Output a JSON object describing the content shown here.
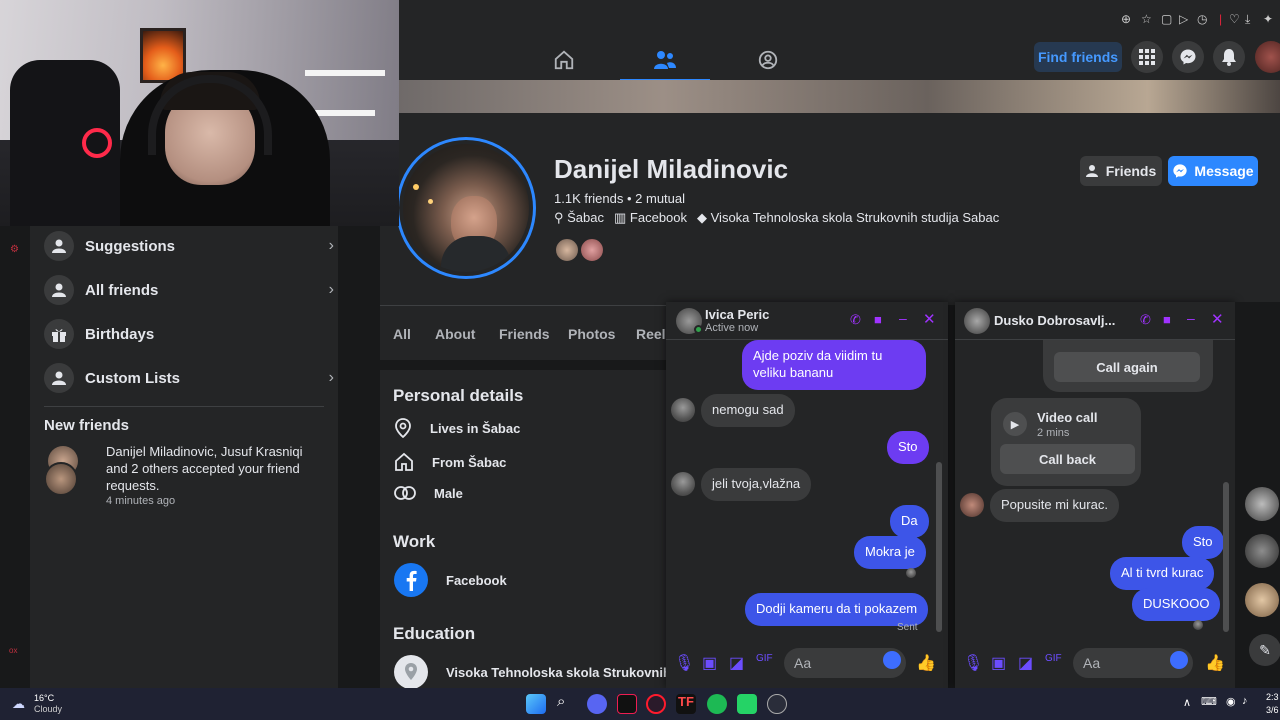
{
  "topnav": {
    "find_friends": "Find friends"
  },
  "profile": {
    "name": "Danijel Miladinovic",
    "friends_line": "1.1K friends • 2 mutual",
    "location": "Šabac",
    "work": "Facebook",
    "school": "Visoka Tehnoloska skola Strukovnih studija Sabac",
    "btn_friends": "Friends",
    "btn_message": "Message"
  },
  "tabs": [
    "All",
    "About",
    "Friends",
    "Photos",
    "Reels"
  ],
  "sidebar": {
    "items": [
      {
        "label": "Suggestions",
        "icon": "person-icon"
      },
      {
        "label": "All friends",
        "icon": "person-icon"
      },
      {
        "label": "Birthdays",
        "icon": "gift-icon"
      },
      {
        "label": "Custom Lists",
        "icon": "list-icon"
      }
    ],
    "new_friends_title": "New friends",
    "notification_text": "Danijel Miladinovic, Jusuf Krasniqi and 2 others accepted your friend requests.",
    "notification_time": "4 minutes ago"
  },
  "intro": {
    "personal_title": "Personal details",
    "lives_in": "Lives in Šabac",
    "from": "From Šabac",
    "gender": "Male",
    "work_title": "Work",
    "work_item": "Facebook",
    "edu_title": "Education",
    "edu_item": "Visoka Tehnoloska skola Strukovnih stu"
  },
  "chat1": {
    "name": "Ivica Peric",
    "status": "Active now",
    "messages": [
      {
        "dir": "out",
        "text": "Ajde poziv da viidim tu veliku bananu"
      },
      {
        "dir": "in",
        "text": "nemogu sad"
      },
      {
        "dir": "out",
        "text": "Sto"
      },
      {
        "dir": "in",
        "text": "jeli tvoja,vlažna"
      },
      {
        "dir": "out",
        "text": "Da"
      },
      {
        "dir": "out",
        "text": "Mokra je"
      },
      {
        "dir": "out",
        "text": "Dodji kameru da ti pokazem"
      }
    ],
    "sent_label": "Sent",
    "input_placeholder": "Aa"
  },
  "chat2": {
    "name": "Dusko Dobrosavlj...",
    "call_again": "Call again",
    "video_call_title": "Video call",
    "video_call_time": "2 mins",
    "call_back": "Call back",
    "messages": [
      {
        "dir": "in",
        "text": "Popusite mi kurac."
      },
      {
        "dir": "out",
        "text": "Sto"
      },
      {
        "dir": "out",
        "text": "Al ti tvrd kurac"
      },
      {
        "dir": "out",
        "text": "DUSKOOO"
      }
    ],
    "input_placeholder": "Aa"
  },
  "taskbar": {
    "weather_temp": "16°C",
    "weather_desc": "Cloudy",
    "time": "2:3",
    "date": "3/6"
  },
  "colors": {
    "accent": "#2d88ff",
    "bubble_purple": "#6d3cf2",
    "bubble_blue": "#3d55e8",
    "panel": "#242526",
    "background": "#18191a"
  }
}
